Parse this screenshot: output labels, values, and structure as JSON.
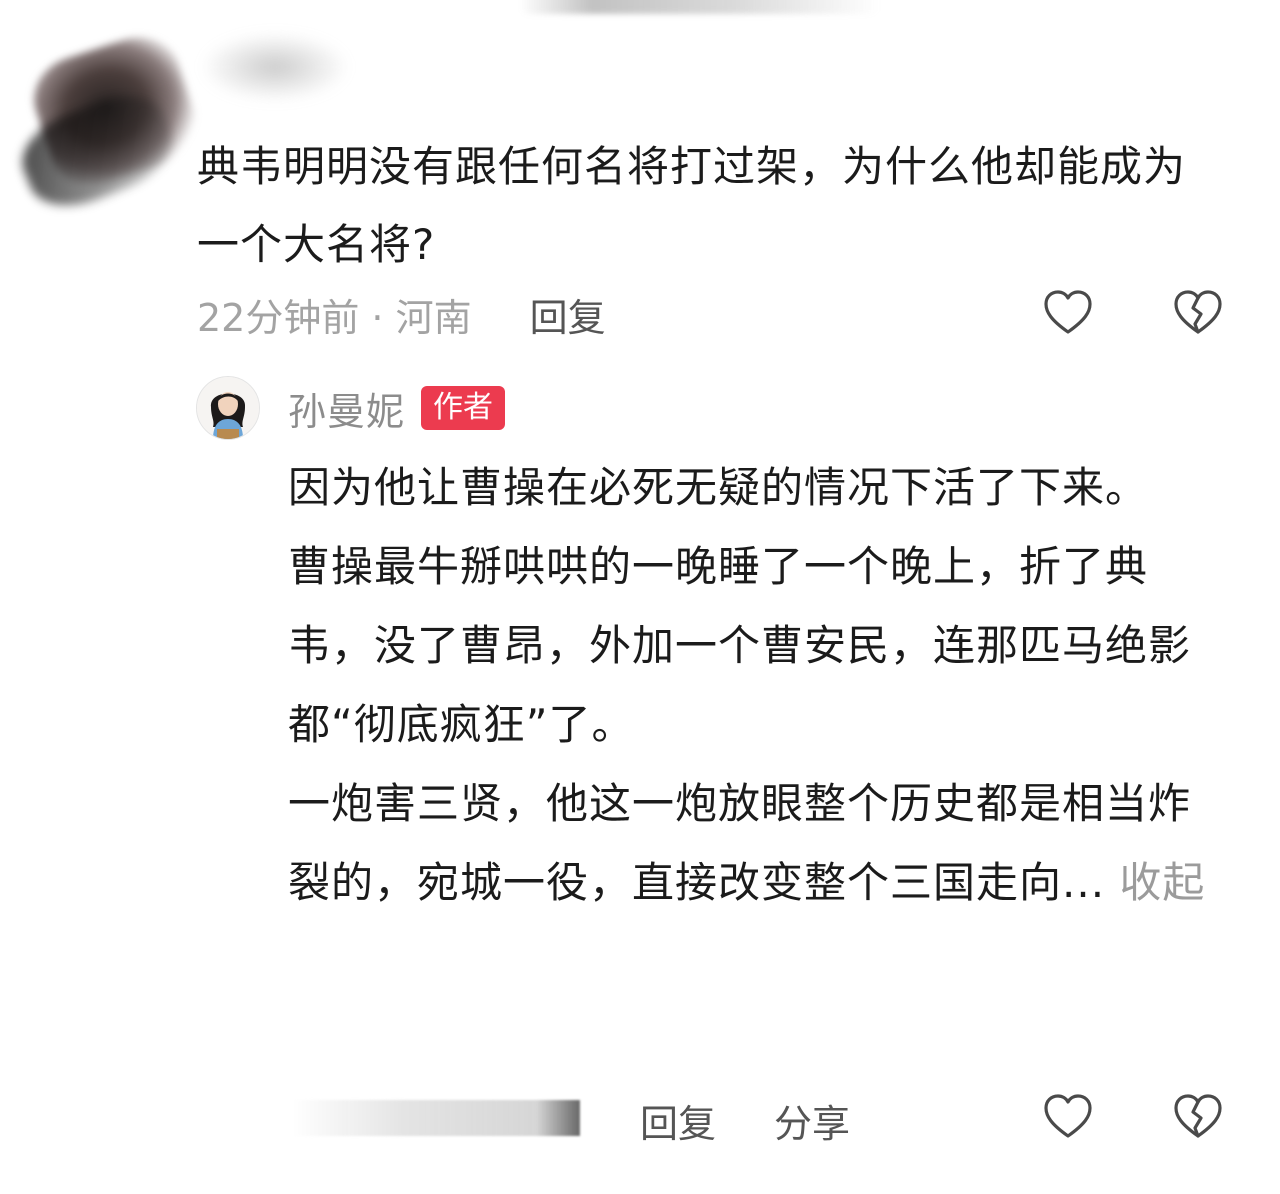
{
  "comment": {
    "text": "典韦明明没有跟任何名将打过架，为什么他却能成为一个大名将?",
    "time_location": "22分钟前 · 河南",
    "reply_label": "回复"
  },
  "author_reply": {
    "name": "孙曼妮",
    "badge": "作者",
    "paragraphs": [
      "因为他让曹操在必死无疑的情况下活了下来。",
      "曹操最牛掰哄哄的一晚睡了一个晚上，折了典韦，没了曹昂，外加一个曹安民，连那匹马绝影都“彻底疯狂”了。",
      "一炮害三贤，他这一炮放眼整个历史都是相当炸裂的，宛城一役，直接改变整个三国走向..."
    ],
    "collapse_label": "收起",
    "reply_label": "回复",
    "share_label": "分享"
  },
  "icons": {
    "like": "heart-outline-icon",
    "dislike": "broken-heart-icon"
  },
  "colors": {
    "badge": "#ec3b4f",
    "muted": "#a3a3a3",
    "text": "#1b1b1b"
  }
}
